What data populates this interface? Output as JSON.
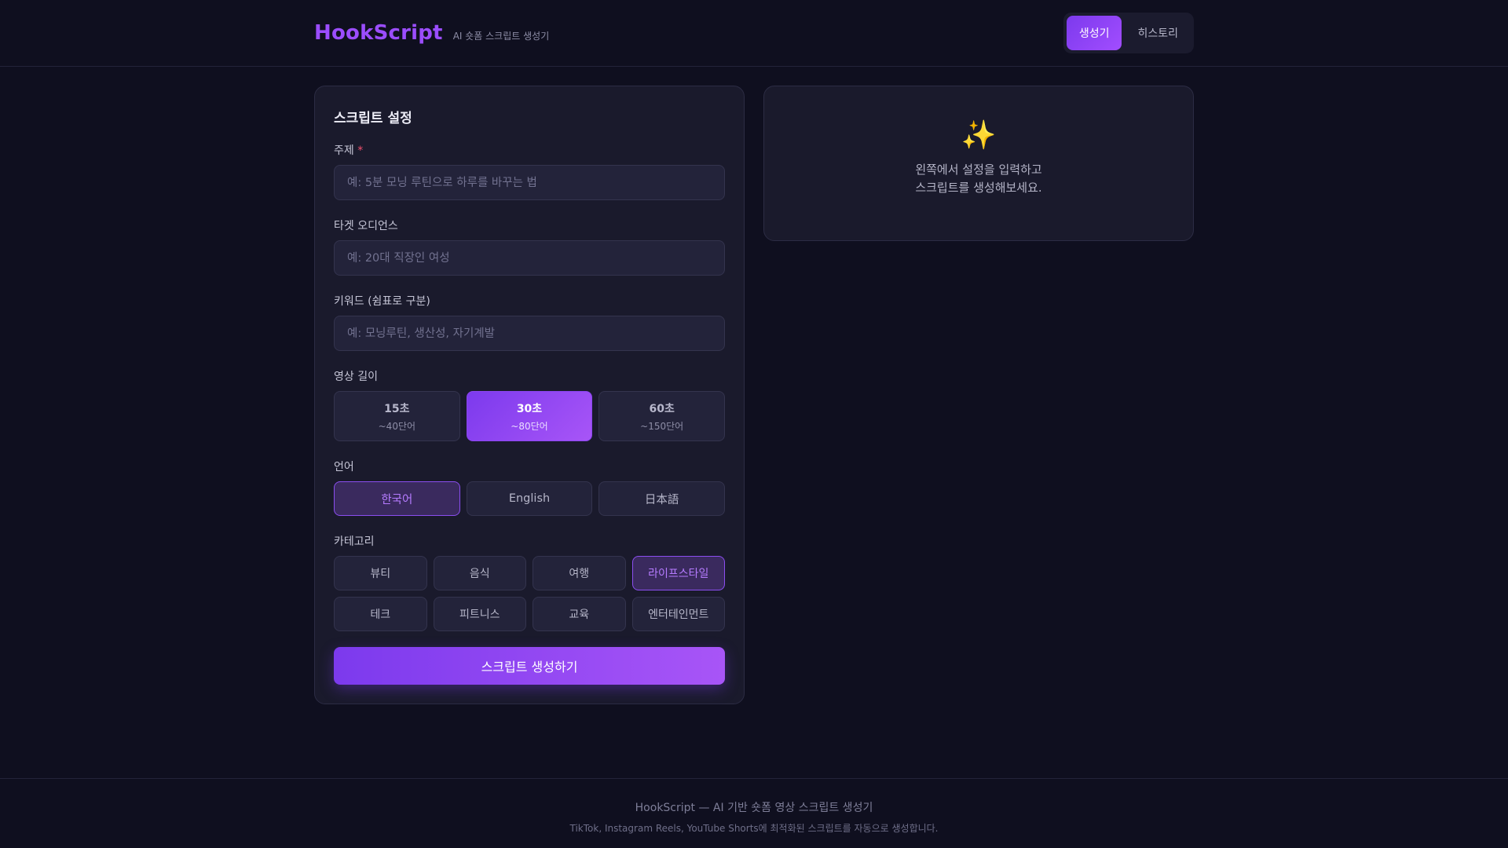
{
  "header": {
    "logo": "HookScript",
    "tagline": "AI 숏폼 스크립트 생성기",
    "nav": [
      {
        "label": "생성기",
        "active": true
      },
      {
        "label": "히스토리",
        "active": false
      }
    ]
  },
  "form": {
    "title": "스크립트 설정",
    "topic": {
      "label": "주제",
      "required_mark": "*",
      "placeholder": "예: 5분 모닝 루틴으로 하루를 바꾸는 법",
      "value": ""
    },
    "audience": {
      "label": "타겟 오디언스",
      "placeholder": "예: 20대 직장인 여성",
      "value": ""
    },
    "keywords": {
      "label": "키워드 (쉼표로 구분)",
      "placeholder": "예: 모닝루틴, 생산성, 자기계발",
      "value": ""
    },
    "duration": {
      "label": "영상 길이",
      "options": [
        {
          "main": "15초",
          "sub": "~40단어",
          "active": false
        },
        {
          "main": "30초",
          "sub": "~80단어",
          "active": true
        },
        {
          "main": "60초",
          "sub": "~150단어",
          "active": false
        }
      ]
    },
    "language": {
      "label": "언어",
      "options": [
        {
          "label": "한국어",
          "active": true
        },
        {
          "label": "English",
          "active": false
        },
        {
          "label": "日本語",
          "active": false
        }
      ]
    },
    "category": {
      "label": "카테고리",
      "options": [
        {
          "label": "뷰티",
          "active": false
        },
        {
          "label": "음식",
          "active": false
        },
        {
          "label": "여행",
          "active": false
        },
        {
          "label": "라이프스타일",
          "active": true
        },
        {
          "label": "테크",
          "active": false
        },
        {
          "label": "피트니스",
          "active": false
        },
        {
          "label": "교육",
          "active": false
        },
        {
          "label": "엔터테인먼트",
          "active": false
        }
      ]
    },
    "submit_label": "스크립트 생성하기"
  },
  "result": {
    "icon": "sparkles-icon",
    "glyph": "✨",
    "line1": "왼쪽에서 설정을 입력하고",
    "line2": "스크립트를 생성해보세요."
  },
  "footer": {
    "line1": "HookScript — AI 기반 숏폼 영상 스크립트 생성기",
    "line2": "TikTok, Instagram Reels, YouTube Shorts에 최적화된 스크립트를 자동으로 생성합니다."
  },
  "colors": {
    "background": "#0f0f1f",
    "accent": "#9b4dff",
    "card": "#1a1a2c"
  }
}
